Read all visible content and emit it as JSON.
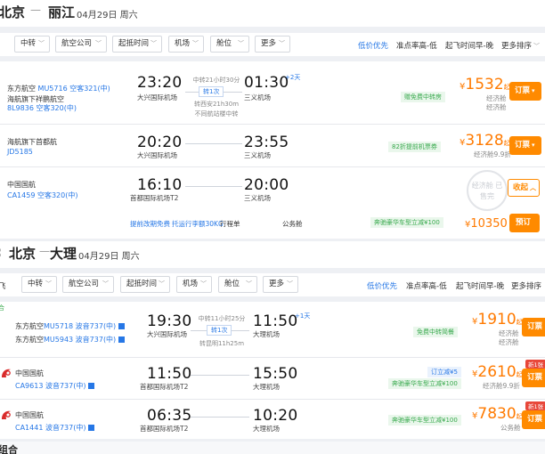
{
  "colors": {
    "accent_blue": "#2677e6",
    "orange": "#ff8a00",
    "price_orange": "#ff7a00",
    "green": "#36a84b",
    "red": "#e8473a"
  },
  "filters": {
    "direct_partial": "",
    "direct_partial_2": "飞",
    "airport_city": "中转",
    "airline": "航空公司",
    "depart_time": "起抵时间",
    "airport": "机场",
    "cabin": "舱位",
    "more": "更多",
    "sort_low_price": "低价优先",
    "sort_punctual": "准点率高-低",
    "sort_depart_early": "起飞时间早-晚",
    "sort_more": "更多排序"
  },
  "route1": {
    "from": "北京",
    "to": "丽江",
    "date": "04月29日 周六",
    "flights": [
      {
        "airline1": "东方航空",
        "flight1": "MU5716",
        "plane1": "空客321(中)",
        "airline2": "海航旗下祥鹏航空",
        "flight2": "8L9836",
        "plane2": "空客320(中)",
        "dep_time": "23:20",
        "dep_airport": "大兴国际机场",
        "arr_time": "01:30",
        "arr_plus": "+2天",
        "arr_airport": "三义机场",
        "transfer_total": "中转21小时30分",
        "transfer_count": "转1次",
        "transfer_city": "转西安21h30m",
        "transfer_note": "不同航站楼中转",
        "badge": "赠免费中转房",
        "price_yen": "¥",
        "price": "1532",
        "price_qi": "起",
        "cabin": "经济舱",
        "cabin2": "经济舱",
        "book": "订票"
      },
      {
        "airline1": "海航旗下首都航",
        "flight1": "JD5185",
        "dep_time": "20:20",
        "dep_airport": "大兴国际机场",
        "arr_time": "23:55",
        "arr_airport": "三义机场",
        "badge": "82折提前机票券",
        "price_yen": "¥",
        "price": "3128",
        "price_qi": "起",
        "cabin": "经济舱9.9折",
        "book": "订票"
      },
      {
        "airline1": "中国国航",
        "flight1": "CA1459",
        "plane1": "空客320(中)",
        "dep_time": "16:10",
        "dep_airport": "首都国际机场T2",
        "arr_time": "20:00",
        "arr_airport": "三义机场",
        "stamp": "经济舱 已售完",
        "collapse": "收起",
        "sub_item1": "提前改期免费",
        "sub_item2": "托运行李额30KG",
        "sub_item3": "行程单",
        "sub_type": "公务舱",
        "sub_badge": "奔驰豪华车型立减¥100",
        "sub_price_yen": "¥",
        "sub_price": "10350",
        "sub_book": "预订"
      }
    ]
  },
  "route2": {
    "from": "北京",
    "to": "大理",
    "date": "04月29日 周六",
    "flights": [
      {
        "airline1": "东方航空",
        "flight1": "MU5718",
        "plane1": "波音737(中)",
        "airline2": "东方航空",
        "flight2": "MU5943",
        "plane2": "波音737(中)",
        "dep_time": "19:30",
        "dep_airport": "大兴国际机场",
        "arr_time": "11:50",
        "arr_plus": "+1天",
        "arr_airport": "大理机场",
        "transfer_total": "中转11小时25分",
        "transfer_count": "转1次",
        "transfer_city": "转昆明11h25m",
        "badge": "免费中转简餐",
        "price_yen": "¥",
        "price": "1910",
        "price_qi": "起",
        "cabin": "经济舱",
        "cabin2": "经济舱",
        "book": "订票"
      },
      {
        "airline1": "中国国航",
        "flight1": "CA9613",
        "plane1": "波音737(中)",
        "dep_time": "11:50",
        "dep_airport": "首都国际机场T2",
        "arr_time": "15:50",
        "arr_airport": "大理机场",
        "badge": "奔驰豪华车型立减¥100",
        "badge2": "订立减¥5",
        "price_yen": "¥",
        "price": "2610",
        "price_qi": "起",
        "cabin": "经济舱9.9折",
        "new_tag": "新1张",
        "book": "订票"
      },
      {
        "airline1": "中国国航",
        "flight1": "CA1441",
        "plane1": "波音737(中)",
        "dep_time": "06:35",
        "dep_airport": "首都国际机场T2",
        "arr_time": "10:20",
        "arr_airport": "大理机场",
        "badge": "奔驰豪华车型立减¥100",
        "price_yen": "¥",
        "price": "7830",
        "price_qi": "起",
        "cabin": "公务舱",
        "new_tag": "新1张",
        "book": "订票"
      }
    ]
  },
  "footer_partial": "组合"
}
